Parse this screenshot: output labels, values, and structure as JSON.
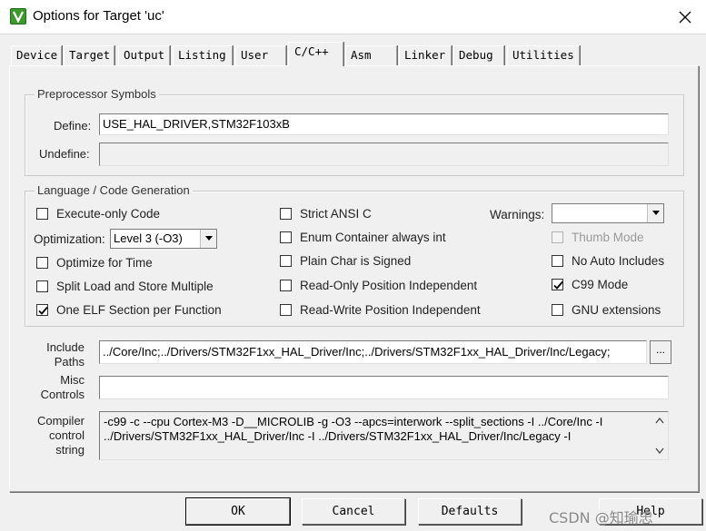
{
  "window": {
    "title": "Options for Target 'uc'",
    "close_icon": "close-icon",
    "app_icon": "keil-uvision-icon"
  },
  "tabs": [
    {
      "label": "Device"
    },
    {
      "label": "Target"
    },
    {
      "label": "Output"
    },
    {
      "label": "Listing"
    },
    {
      "label": "User"
    },
    {
      "label": "C/C++",
      "active": true
    },
    {
      "label": "Asm"
    },
    {
      "label": "Linker"
    },
    {
      "label": "Debug"
    },
    {
      "label": "Utilities"
    }
  ],
  "preprocessor": {
    "legend": "Preprocessor Symbols",
    "define_label": "Define:",
    "define_value": "USE_HAL_DRIVER,STM32F103xB",
    "undefine_label": "Undefine:",
    "undefine_value": ""
  },
  "codegen": {
    "legend": "Language / Code Generation",
    "execute_only": {
      "label": "Execute-only Code",
      "checked": false
    },
    "optimization_label": "Optimization:",
    "optimization_value": "Level 3 (-O3)",
    "optimize_time": {
      "label": "Optimize for Time",
      "checked": false
    },
    "split_load": {
      "label": "Split Load and Store Multiple",
      "checked": false
    },
    "one_elf": {
      "label": "One ELF Section per Function",
      "checked": true
    },
    "strict_ansi": {
      "label": "Strict ANSI C",
      "checked": false
    },
    "enum_container": {
      "label": "Enum Container always int",
      "checked": false
    },
    "plain_char": {
      "label": "Plain Char is Signed",
      "checked": false
    },
    "ro_pos": {
      "label": "Read-Only Position Independent",
      "checked": false
    },
    "rw_pos": {
      "label": "Read-Write Position Independent",
      "checked": false
    },
    "warnings_label": "Warnings:",
    "warnings_value": "",
    "thumb_mode": {
      "label": "Thumb Mode",
      "checked": false,
      "disabled": true
    },
    "no_auto_includes": {
      "label": "No Auto Includes",
      "checked": false
    },
    "c99_mode": {
      "label": "C99 Mode",
      "checked": true
    },
    "gnu_ext": {
      "label": "GNU extensions",
      "checked": false
    }
  },
  "include": {
    "label_line1": "Include",
    "label_line2": "Paths",
    "value": "../Core/Inc;../Drivers/STM32F1xx_HAL_Driver/Inc;../Drivers/STM32F1xx_HAL_Driver/Inc/Legacy;",
    "browse_label": "..."
  },
  "misc": {
    "label_line1": "Misc",
    "label_line2": "Controls",
    "value": ""
  },
  "compiler": {
    "label_line1": "Compiler",
    "label_line2": "control",
    "label_line3": "string",
    "line1": "-c99 -c --cpu Cortex-M3 -D__MICROLIB -g -O3 --apcs=interwork --split_sections -I ../Core/Inc -I",
    "line2": "../Drivers/STM32F1xx_HAL_Driver/Inc -I ../Drivers/STM32F1xx_HAL_Driver/Inc/Legacy -I"
  },
  "buttons": {
    "ok": "OK",
    "cancel": "Cancel",
    "defaults": "Defaults",
    "help": "Help"
  },
  "watermark": "CSDN @知瑜忠"
}
